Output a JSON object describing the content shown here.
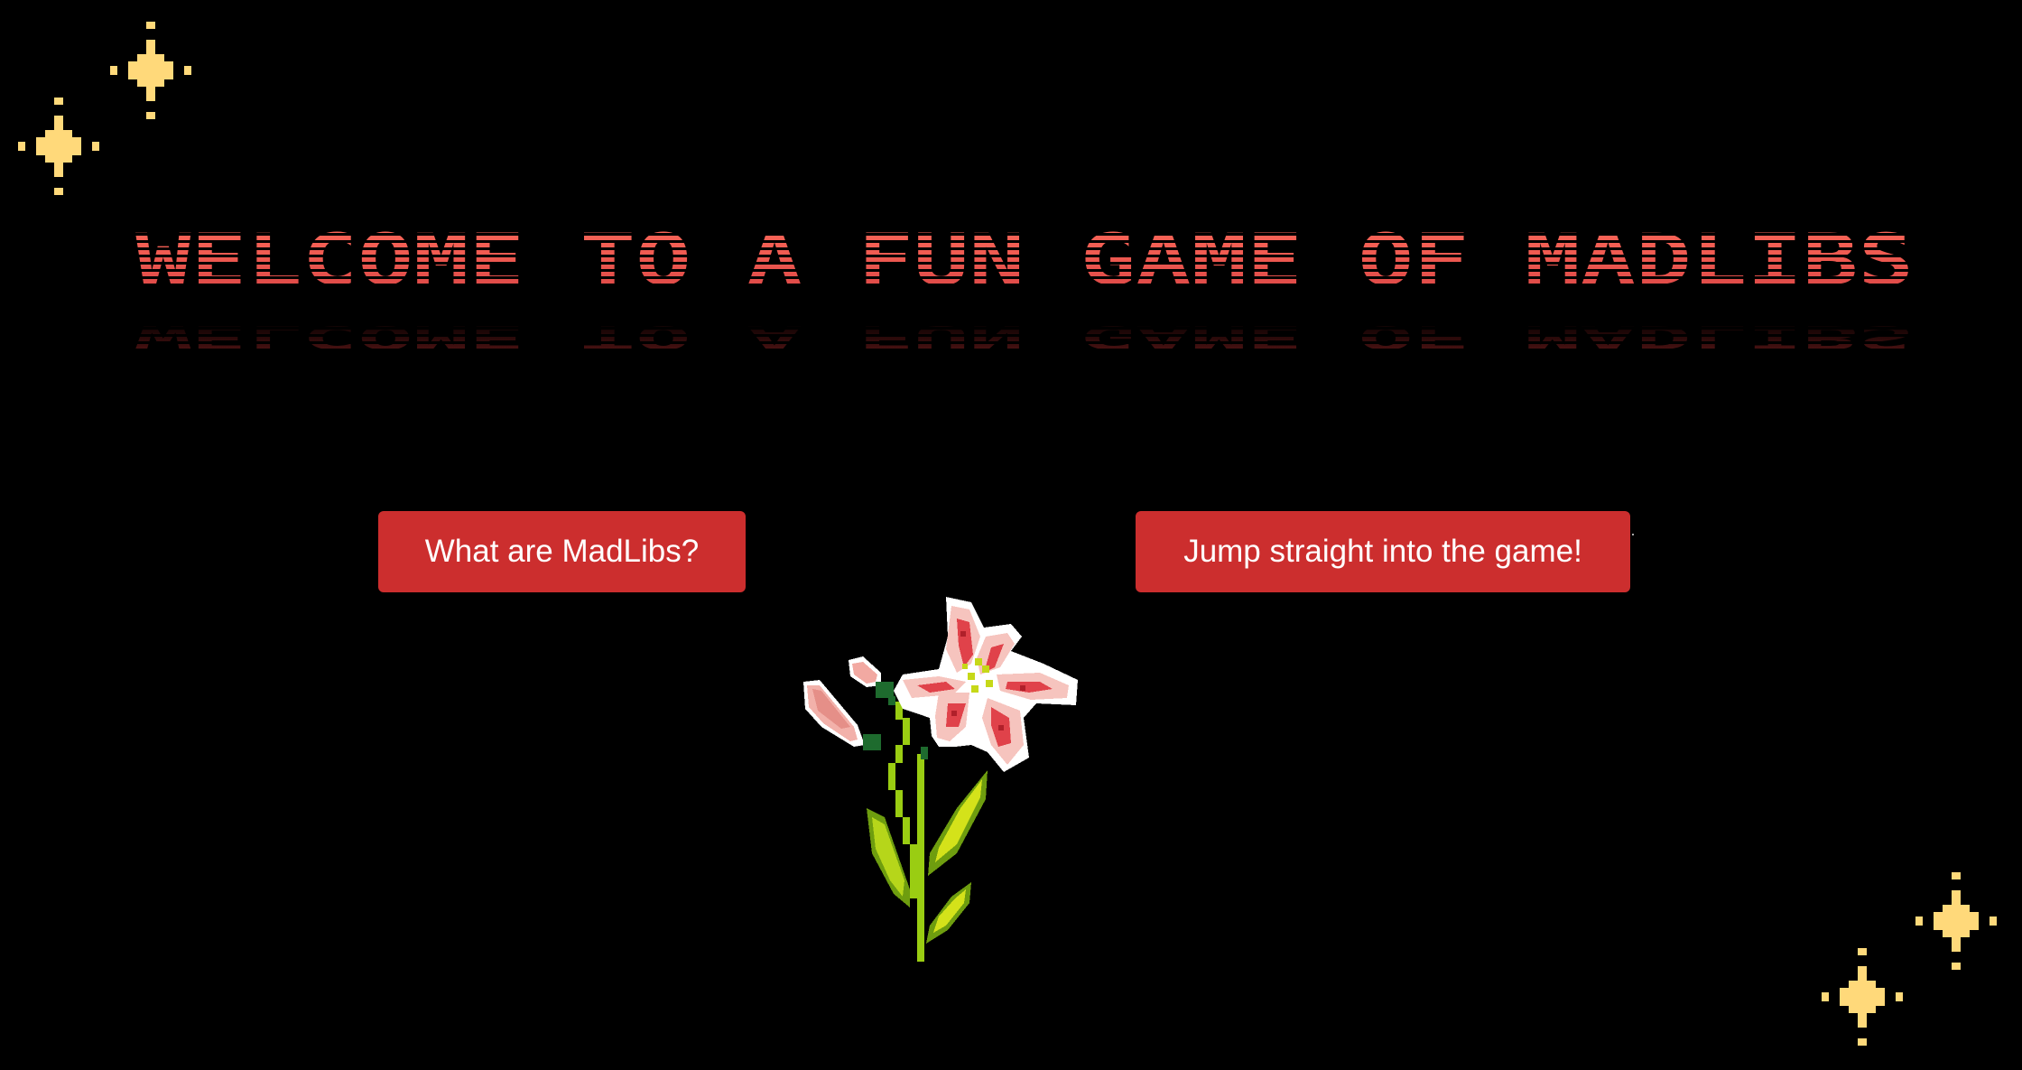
{
  "title": {
    "text": "WELCOME TO A FUN GAME OF MADLIBS",
    "color_top": "#ff5a50",
    "color_bottom": "#d84a4a"
  },
  "buttons": {
    "what_label": "What are MadLibs?",
    "jump_label": "Jump straight into the game!"
  },
  "colors": {
    "background": "#000000",
    "button": "#cc2e2e",
    "button_text": "#ffffff",
    "sparkle": "#ffd97a"
  },
  "decorations": {
    "sparkle_icon": "four-point-star-icon",
    "flower_icon": "pixel-lily-flower-icon"
  }
}
